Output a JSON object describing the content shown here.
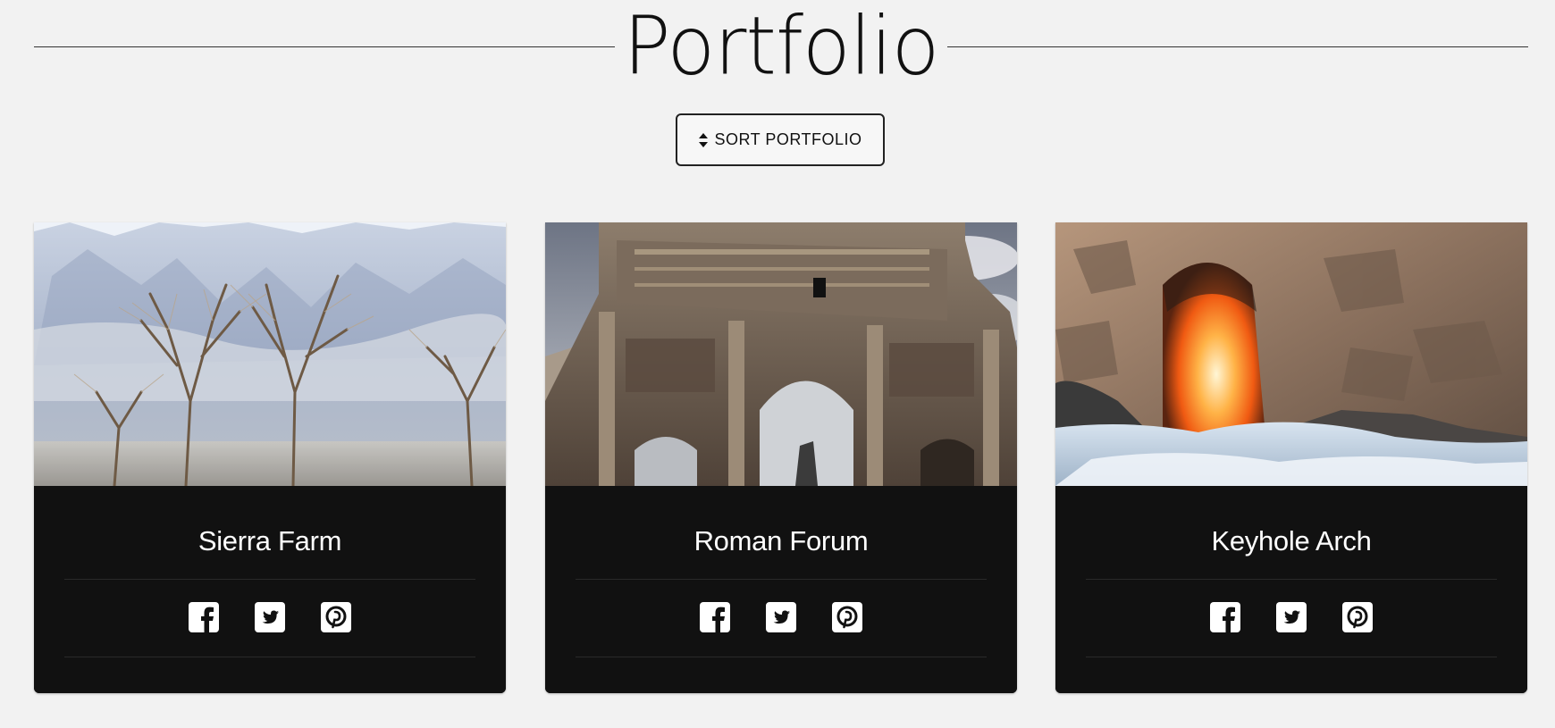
{
  "page": {
    "title": "Portfolio",
    "sort_button_label": "SORT PORTFOLIO",
    "sort_icon": "sort-icon"
  },
  "colors": {
    "background": "#f2f2f2",
    "card_background": "#111111",
    "card_text": "#ffffff",
    "rule": "#333333"
  },
  "cards": [
    {
      "title": "Sierra Farm",
      "image": "snowy mountain with bare winter trees",
      "social_icons": [
        "facebook-icon",
        "twitter-icon",
        "pinterest-icon"
      ]
    },
    {
      "title": "Roman Forum",
      "image": "ancient triumphal arch ruins",
      "social_icons": [
        "facebook-icon",
        "twitter-icon",
        "pinterest-icon"
      ]
    },
    {
      "title": "Keyhole Arch",
      "image": "sunlit rock arch over ocean surf",
      "social_icons": [
        "facebook-icon",
        "twitter-icon",
        "pinterest-icon"
      ]
    }
  ]
}
